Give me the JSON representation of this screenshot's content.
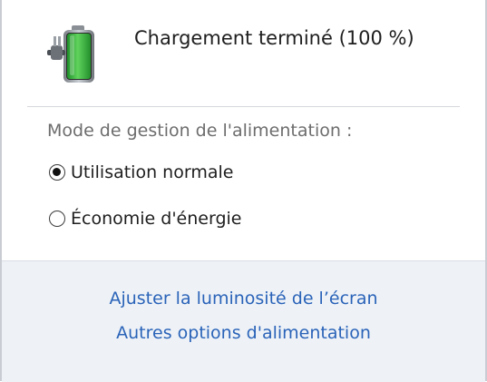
{
  "battery": {
    "icon": "battery-charging-plug-icon",
    "status_text": "Chargement terminé (100 %)",
    "level_fraction": 1.0,
    "fill_color": "#35b53c"
  },
  "power_plan": {
    "heading": "Mode de gestion de l'alimentation :",
    "options": [
      {
        "label": "Utilisation normale",
        "selected": true
      },
      {
        "label": "Économie d'énergie",
        "selected": false
      }
    ]
  },
  "links": {
    "brightness": "Ajuster la luminosité de l’écran",
    "more_options": "Autres options d'alimentation",
    "color": "#2a63b8"
  }
}
